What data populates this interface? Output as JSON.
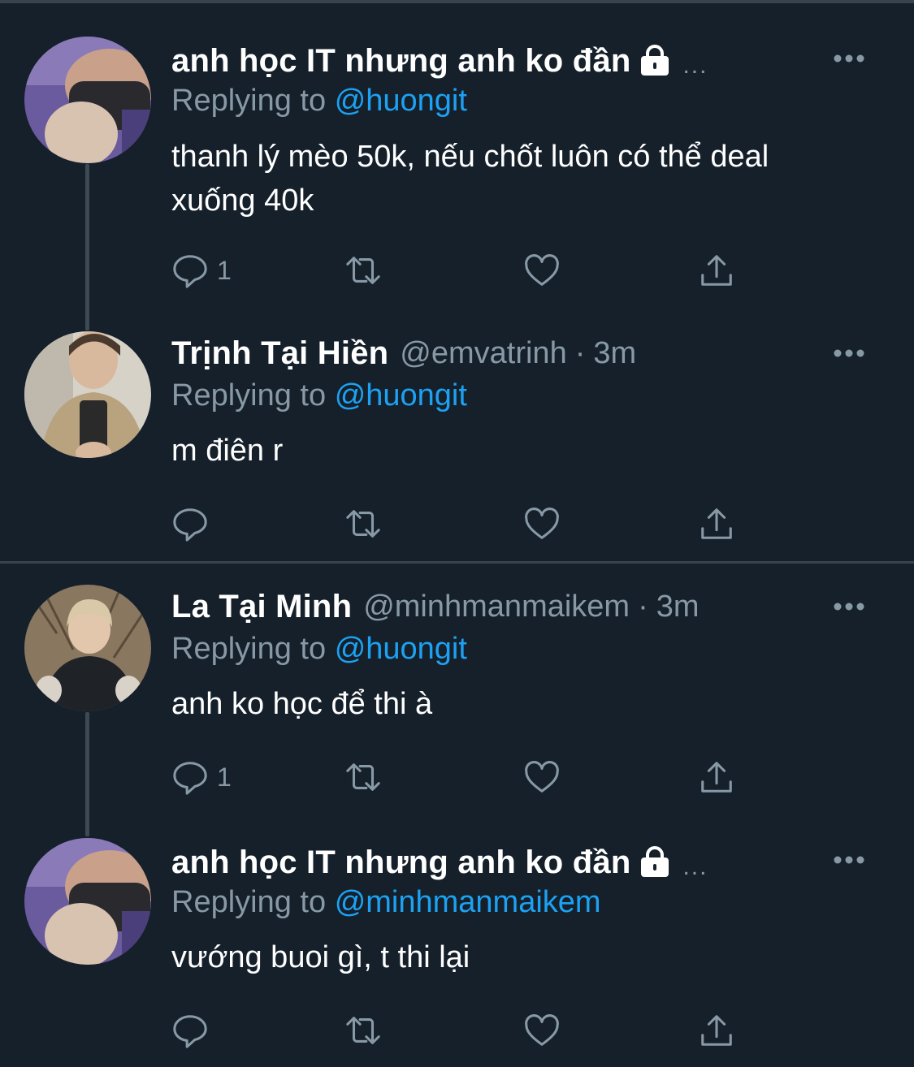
{
  "tweets": [
    {
      "display_name": "anh học IT nhưng anh ko đần",
      "protected": true,
      "truncated": "...",
      "replying_prefix": "Replying to",
      "replying_to": "@huongit",
      "text": "thanh lý mèo 50k, nếu chốt luôn có thể deal xuống 40k",
      "reply_count": "1"
    },
    {
      "display_name": "Trịnh Tại Hiền",
      "handle": "@emvatrinh",
      "separator": "·",
      "time": "3m",
      "replying_prefix": "Replying to",
      "replying_to": "@huongit",
      "text": "m điên r",
      "reply_count": ""
    },
    {
      "display_name": "La Tại Minh",
      "handle": "@minhmanmaikem",
      "separator": "·",
      "time": "3m",
      "replying_prefix": "Replying to",
      "replying_to": "@huongit",
      "text": "anh ko học để thi à",
      "reply_count": "1"
    },
    {
      "display_name": "anh học IT nhưng anh ko đần",
      "protected": true,
      "truncated": "...",
      "replying_prefix": "Replying to",
      "replying_to": "@minhmanmaikem",
      "text": "vướng buoi gì, t thi lại",
      "reply_count": ""
    }
  ],
  "icons": {
    "reply": "reply-icon",
    "retweet": "retweet-icon",
    "like": "like-icon",
    "share": "share-icon",
    "more": "more-icon",
    "lock": "lock-icon"
  },
  "colors": {
    "background": "#15202b",
    "divider": "#38444d",
    "secondary_text": "#8899a6",
    "link": "#1da1f2",
    "primary_text": "#ffffff"
  }
}
